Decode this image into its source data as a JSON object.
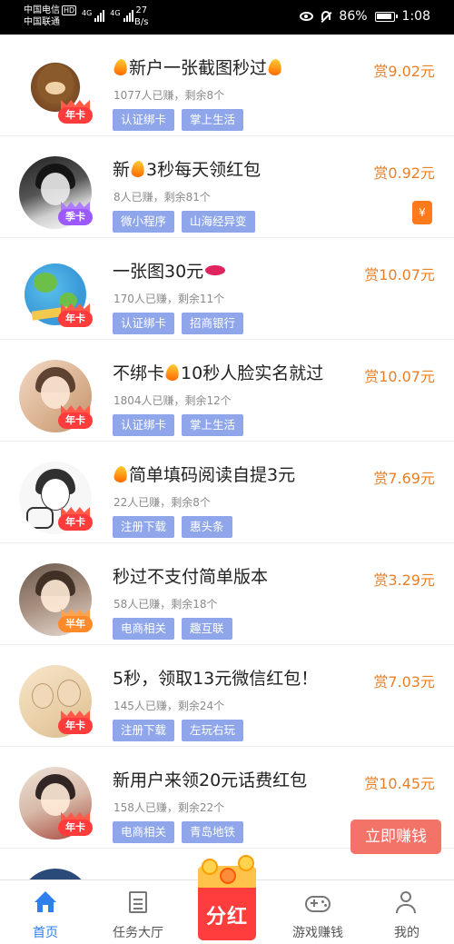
{
  "status_bar": {
    "carrier1": "中国电信",
    "carrier1_badge": "HD",
    "carrier2": "中国联通",
    "network1": "4G",
    "network2": "4G",
    "speed_value": "27",
    "speed_unit": "B/s",
    "battery": "86%",
    "time": "1:08"
  },
  "tasks": [
    {
      "title_parts": [
        "",
        "新户一张截图秒过",
        ""
      ],
      "reward": "赏9.02元",
      "meta": "1077人已赚，剩余8个",
      "tags": [
        "认证绑卡",
        "掌上生活"
      ],
      "badge": "年卡"
    },
    {
      "title_parts": [
        "新",
        "3秒每天领红包"
      ],
      "reward": "赏0.92元",
      "meta": "8人已赚，剩余81个",
      "tags": [
        "微小程序",
        "山海经异变"
      ],
      "badge": "季卡",
      "side_badge": "¥"
    },
    {
      "title_parts": [
        "一张图30元"
      ],
      "reward": "赏10.07元",
      "meta": "170人已赚，剩余11个",
      "tags": [
        "认证绑卡",
        "招商银行"
      ],
      "badge": "年卡"
    },
    {
      "title_parts": [
        "不绑卡",
        "10秒人脸实名就过"
      ],
      "reward": "赏10.07元",
      "meta": "1804人已赚，剩余12个",
      "tags": [
        "认证绑卡",
        "掌上生活"
      ],
      "badge": "年卡"
    },
    {
      "title_parts": [
        "",
        "简单填码阅读自提3元"
      ],
      "reward": "赏7.69元",
      "meta": "22人已赚，剩余8个",
      "tags": [
        "注册下载",
        "惠头条"
      ],
      "badge": "年卡"
    },
    {
      "title_parts": [
        "秒过不支付简单版本"
      ],
      "reward": "赏3.29元",
      "meta": "58人已赚，剩余18个",
      "tags": [
        "电商相关",
        "趣互联"
      ],
      "badge": "半年"
    },
    {
      "title_parts": [
        "5秒，领取13元微信红包！"
      ],
      "reward": "赏7.03元",
      "meta": "145人已赚，剩余24个",
      "tags": [
        "注册下载",
        "左玩右玩"
      ],
      "badge": "年卡"
    },
    {
      "title_parts": [
        "新用户来领20元话费红包"
      ],
      "reward": "赏10.45元",
      "meta": "158人已赚，剩余22个",
      "tags": [
        "电商相关",
        "青岛地铁"
      ],
      "badge": "年卡"
    }
  ],
  "earn_button": "立即赚钱",
  "tabbar": {
    "home": "首页",
    "tasks": "任务大厅",
    "center": "分红",
    "games": "游戏赚钱",
    "mine": "我的"
  },
  "colors": {
    "accent": "#2f80ed",
    "reward": "#e8802a",
    "tag": "#8fa6ea",
    "badge": "#ff3b3b",
    "earn_button": "#f37368"
  }
}
